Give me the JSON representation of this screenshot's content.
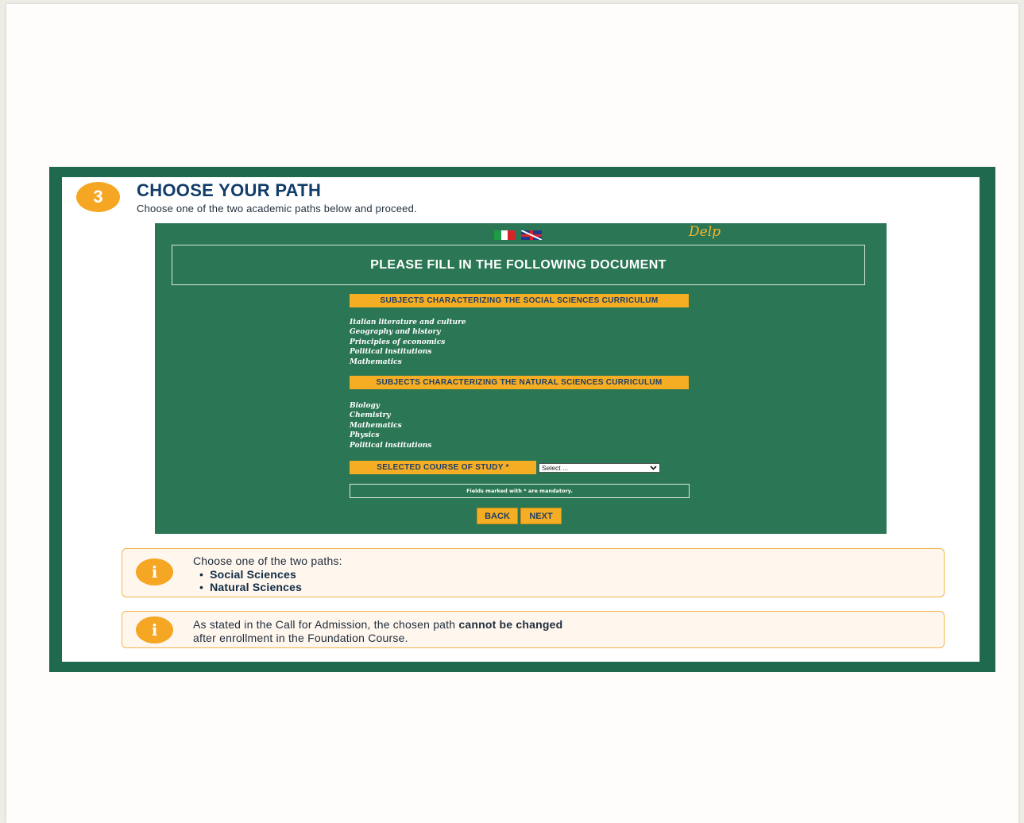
{
  "step": {
    "number": "3",
    "title": "CHOOSE YOUR PATH",
    "subtitle": "Choose one of the two academic paths below and proceed."
  },
  "form": {
    "brand": "Delp",
    "document_title": "PLEASE FILL IN THE FOLLOWING DOCUMENT",
    "social_heading": "SUBJECTS CHARACTERIZING THE SOCIAL SCIENCES CURRICULUM",
    "social_subjects": [
      "Italian literature and culture",
      "Geography and history",
      "Principles of economics",
      "Political institutions",
      "Mathematics"
    ],
    "natural_heading": "SUBJECTS CHARACTERIZING THE NATURAL SCIENCES CURRICULUM",
    "natural_subjects": [
      "Biology",
      "Chemistry",
      "Mathematics",
      "Physics",
      "Political institutions"
    ],
    "course_label": "SELECTED COURSE OF STUDY *",
    "course_select_value": "Select ...",
    "mandatory_note": "Fields marked with * are mandatory.",
    "back_label": "BACK",
    "next_label": "NEXT",
    "flags": [
      "italian-flag-icon",
      "uk-flag-icon"
    ]
  },
  "info1": {
    "text": "Choose one of the two paths:",
    "items": [
      "Social Sciences",
      "Natural Sciences"
    ]
  },
  "info2": {
    "text_before": "As stated in the Call for Admission, the chosen path ",
    "text_bold": "cannot be changed",
    "text_after": "after enrollment in the Foundation Course."
  },
  "colors": {
    "frame_green": "#1f6a4e",
    "panel_green": "#2b7755",
    "accent_orange": "#f5a623",
    "title_navy": "#123c6a"
  }
}
